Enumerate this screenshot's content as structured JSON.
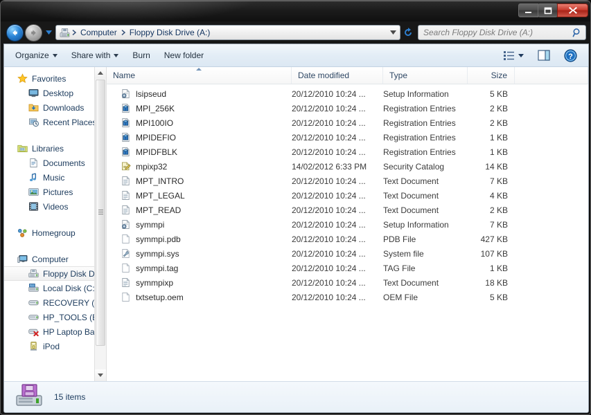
{
  "window": {
    "controls": {
      "minimize": "Minimize",
      "maximize": "Maximize",
      "close": "Close"
    }
  },
  "address": {
    "back": "Back",
    "forward": "Forward",
    "history": "Recent pages",
    "refresh": "Refresh",
    "drive_icon": "floppy-disk-icon",
    "crumbs": [
      "Computer",
      "Floppy Disk Drive (A:)"
    ]
  },
  "search": {
    "placeholder": "Search Floppy Disk Drive (A:)",
    "value": ""
  },
  "toolbar": {
    "organize": "Organize",
    "share_with": "Share with",
    "burn": "Burn",
    "new_folder": "New folder",
    "views": "Change your view",
    "preview_pane": "Show the preview pane",
    "help": "Get help"
  },
  "navpane": {
    "groups": [
      {
        "header": {
          "label": "Favorites",
          "icon": "star-icon"
        },
        "items": [
          {
            "label": "Desktop",
            "icon": "desktop-icon"
          },
          {
            "label": "Downloads",
            "icon": "downloads-folder-icon"
          },
          {
            "label": "Recent Places",
            "icon": "recent-places-icon"
          }
        ]
      },
      {
        "header": {
          "label": "Libraries",
          "icon": "libraries-icon"
        },
        "items": [
          {
            "label": "Documents",
            "icon": "document-icon"
          },
          {
            "label": "Music",
            "icon": "music-note-icon"
          },
          {
            "label": "Pictures",
            "icon": "picture-icon"
          },
          {
            "label": "Videos",
            "icon": "video-film-icon"
          }
        ]
      },
      {
        "header": {
          "label": "Homegroup",
          "icon": "homegroup-icon"
        },
        "items": []
      },
      {
        "header": {
          "label": "Computer",
          "icon": "computer-icon"
        },
        "items": [
          {
            "label": "Floppy Disk Drive (A:)",
            "icon": "floppy-drive-icon",
            "selected": true
          },
          {
            "label": "Local Disk (C:)",
            "icon": "hard-disk-icon"
          },
          {
            "label": "RECOVERY (D:)",
            "icon": "drive-icon"
          },
          {
            "label": "HP_TOOLS (E:)",
            "icon": "drive-icon"
          },
          {
            "label": "HP Laptop Backup",
            "icon": "disconnected-drive-icon"
          },
          {
            "label": "iPod",
            "icon": "ipod-icon"
          }
        ]
      }
    ]
  },
  "filelist": {
    "columns": [
      {
        "key": "name",
        "label": "Name",
        "sorted": true
      },
      {
        "key": "date",
        "label": "Date modified",
        "sorted": false
      },
      {
        "key": "type",
        "label": "Type",
        "sorted": false
      },
      {
        "key": "size",
        "label": "Size",
        "sorted": false
      }
    ],
    "rows": [
      {
        "name": "lsipseud",
        "date": "20/12/2010 10:24 ...",
        "type": "Setup Information",
        "size": "5 KB",
        "icon": "setup-information-icon"
      },
      {
        "name": "MPI_256K",
        "date": "20/12/2010 10:24 ...",
        "type": "Registration Entries",
        "size": "2 KB",
        "icon": "registration-entries-icon"
      },
      {
        "name": "MPI100IO",
        "date": "20/12/2010 10:24 ...",
        "type": "Registration Entries",
        "size": "2 KB",
        "icon": "registration-entries-icon"
      },
      {
        "name": "MPIDEFIO",
        "date": "20/12/2010 10:24 ...",
        "type": "Registration Entries",
        "size": "1 KB",
        "icon": "registration-entries-icon"
      },
      {
        "name": "MPIDFBLK",
        "date": "20/12/2010 10:24 ...",
        "type": "Registration Entries",
        "size": "1 KB",
        "icon": "registration-entries-icon"
      },
      {
        "name": "mpixp32",
        "date": "14/02/2012 6:33 PM",
        "type": "Security Catalog",
        "size": "14 KB",
        "icon": "security-catalog-icon"
      },
      {
        "name": "MPT_INTRO",
        "date": "20/12/2010 10:24 ...",
        "type": "Text Document",
        "size": "7 KB",
        "icon": "text-document-icon"
      },
      {
        "name": "MPT_LEGAL",
        "date": "20/12/2010 10:24 ...",
        "type": "Text Document",
        "size": "4 KB",
        "icon": "text-document-icon"
      },
      {
        "name": "MPT_READ",
        "date": "20/12/2010 10:24 ...",
        "type": "Text Document",
        "size": "2 KB",
        "icon": "text-document-icon"
      },
      {
        "name": "symmpi",
        "date": "20/12/2010 10:24 ...",
        "type": "Setup Information",
        "size": "7 KB",
        "icon": "setup-information-icon"
      },
      {
        "name": "symmpi.pdb",
        "date": "20/12/2010 10:24 ...",
        "type": "PDB File",
        "size": "427 KB",
        "icon": "generic-file-icon"
      },
      {
        "name": "symmpi.sys",
        "date": "20/12/2010 10:24 ...",
        "type": "System file",
        "size": "107 KB",
        "icon": "system-file-icon"
      },
      {
        "name": "symmpi.tag",
        "date": "20/12/2010 10:24 ...",
        "type": "TAG File",
        "size": "1 KB",
        "icon": "generic-file-icon"
      },
      {
        "name": "symmpixp",
        "date": "20/12/2010 10:24 ...",
        "type": "Text Document",
        "size": "18 KB",
        "icon": "text-document-icon"
      },
      {
        "name": "txtsetup.oem",
        "date": "20/12/2010 10:24 ...",
        "type": "OEM File",
        "size": "5 KB",
        "icon": "generic-file-icon"
      }
    ]
  },
  "statusbar": {
    "icon": "floppy-disk-drive-icon",
    "text": "15 items"
  },
  "colors": {
    "titlebar": "#141414",
    "close_button": "#c7392b",
    "toolbar": "#e3edf6",
    "link_text": "#1b3a5c",
    "accent_blue": "#2c86d8"
  }
}
